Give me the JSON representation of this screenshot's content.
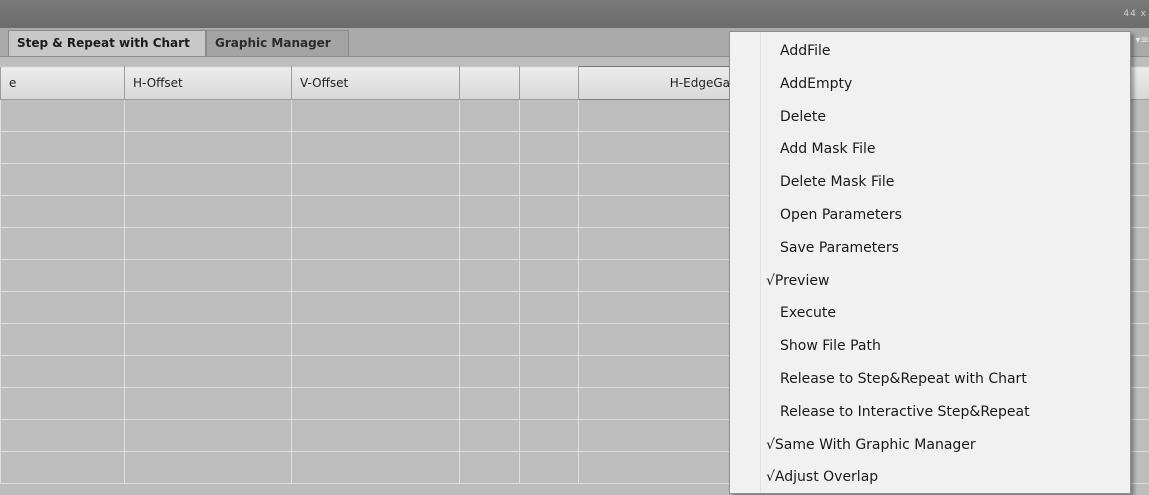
{
  "window": {
    "controls": "44  x"
  },
  "tabs": [
    {
      "label": "Step & Repeat with Chart",
      "active": true
    },
    {
      "label": "Graphic Manager",
      "active": false
    }
  ],
  "panel_menu_icon": "▾≡",
  "table": {
    "headers": [
      "e",
      "H-Offset",
      "V-Offset",
      "",
      "",
      "H-EdgeGa",
      "",
      "",
      ""
    ],
    "row_count": 12
  },
  "context_menu": {
    "items": [
      {
        "label": "AddFile"
      },
      {
        "label": "AddEmpty"
      },
      {
        "label": "Delete"
      },
      {
        "label": "Add Mask File"
      },
      {
        "label": "Delete Mask File"
      },
      {
        "label": "Open Parameters"
      },
      {
        "label": "Save Parameters"
      },
      {
        "label": "√Preview",
        "checked": true
      },
      {
        "label": "Execute"
      },
      {
        "label": "Show File Path"
      },
      {
        "label": "Release to Step&Repeat with Chart"
      },
      {
        "label": "Release to Interactive Step&Repeat"
      },
      {
        "label": "√Same With Graphic Manager",
        "checked": true
      },
      {
        "label": "√Adjust Overlap",
        "checked": true
      }
    ]
  }
}
